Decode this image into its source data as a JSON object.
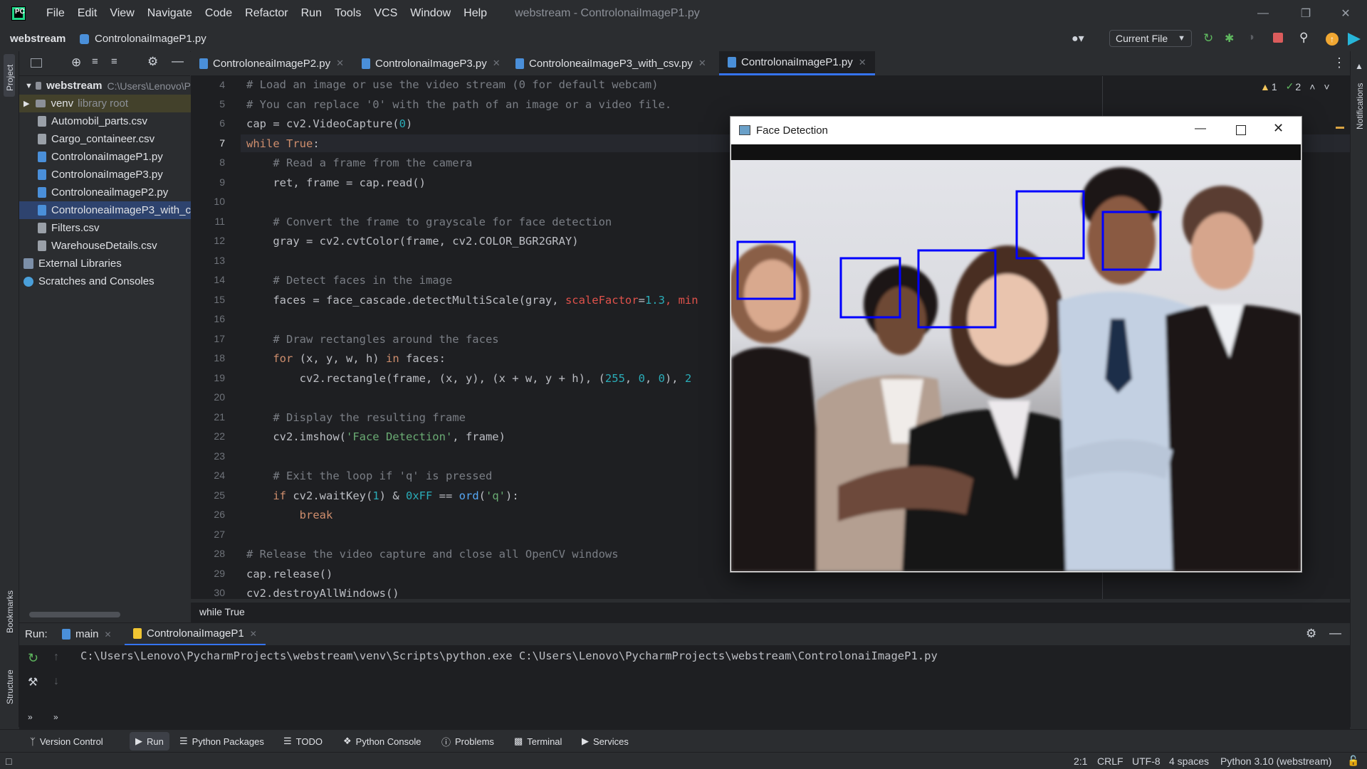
{
  "window": {
    "title": "webstream - ControlonaiImageP1.py"
  },
  "menu": [
    "File",
    "Edit",
    "View",
    "Navigate",
    "Code",
    "Refactor",
    "Run",
    "Tools",
    "VCS",
    "Window",
    "Help"
  ],
  "nav": {
    "project": "webstream",
    "file": "ControlonaiImageP1.py",
    "run_config": "Current File"
  },
  "left_stripe": {
    "project": "Project",
    "bookmarks": "Bookmarks",
    "structure": "Structure"
  },
  "right_stripe": {
    "notifications": "Notifications"
  },
  "project_tree": {
    "root": {
      "name": "webstream",
      "path": "C:\\Users\\Lenovo\\Py"
    },
    "venv": {
      "name": "venv",
      "hint": "library root"
    },
    "files": [
      "Automobil_parts.csv",
      "Cargo_containeer.csv",
      "ControlonaiImageP1.py",
      "ControlonaiImageP3.py",
      "ControloneailmageP2.py",
      "ControloneaiImageP3_with_c",
      "Filters.csv",
      "WarehouseDetails.csv"
    ],
    "external": "External Libraries",
    "scratches": "Scratches and Consoles"
  },
  "tabs": [
    "ControloneaiImageP2.py",
    "ControlonaiImageP3.py",
    "ControloneaiImageP3_with_csv.py",
    "ControlonaiImageP1.py"
  ],
  "inspections": {
    "warnings": "1",
    "checks": "2"
  },
  "line_numbers": [
    "4",
    "5",
    "6",
    "7",
    "8",
    "9",
    "10",
    "11",
    "12",
    "13",
    "14",
    "15",
    "16",
    "17",
    "18",
    "19",
    "20",
    "21",
    "22",
    "23",
    "24",
    "25",
    "26",
    "27",
    "28",
    "29",
    "30"
  ],
  "code": {
    "l4": "# Load an image or use the video stream (0 for default webcam)",
    "l5": "# You can replace '0' with the path of an image or a video file.",
    "l6a": "cap = cv2.VideoCapture(",
    "l6b": "0",
    "l6c": ")",
    "l7a": "while True",
    "l7b": ":",
    "l8": "    # Read a frame from the camera",
    "l9": "    ret, frame = cap.read()",
    "l11": "    # Convert the frame to grayscale for face detection",
    "l12": "    gray = cv2.cvtColor(frame, cv2.COLOR_BGR2GRAY)",
    "l14": "    # Detect faces in the image",
    "l15a": "    faces = face_cascade.detectMultiScale(gray, ",
    "l15b": "scaleFactor",
    "l15c": "=",
    "l15d": "1.3",
    "l15e": ", min",
    "l17": "    # Draw rectangles around the faces",
    "l18a": "    for",
    "l18b": " (x, y, w, h) ",
    "l18c": "in",
    "l18d": " faces:",
    "l19a": "        cv2.rectangle(frame, (x, y), (x + w, y + h), (",
    "l19b": "255",
    "l19c": ", ",
    "l19d": "0",
    "l19e": ", ",
    "l19f": "0",
    "l19g": "), ",
    "l19h": "2",
    "l21": "    # Display the resulting frame",
    "l22a": "    cv2.imshow(",
    "l22b": "'Face Detection'",
    "l22c": ", frame)",
    "l24": "    # Exit the loop if 'q' is pressed",
    "l25a": "    if",
    "l25b": " cv2.waitKey(",
    "l25c": "1",
    "l25d": ") & ",
    "l25e": "0xFF",
    "l25f": " == ",
    "l25g": "ord",
    "l25h": "(",
    "l25i": "'q'",
    "l25j": "):",
    "l26": "        break",
    "l28": "# Release the video capture and close all OpenCV windows",
    "l29": "cap.release()",
    "l30": "cv2.destroyAllWindows()"
  },
  "breadcrumb": "while True",
  "run": {
    "label": "Run:",
    "tabs": [
      "main",
      "ControlonaiImageP1"
    ],
    "output": "C:\\Users\\Lenovo\\PycharmProjects\\webstream\\venv\\Scripts\\python.exe C:\\Users\\Lenovo\\PycharmProjects\\webstream\\ControlonaiImageP1.py"
  },
  "bottom_tabs": [
    "Version Control",
    "Run",
    "Python Packages",
    "TODO",
    "Python Console",
    "Problems",
    "Terminal",
    "Services"
  ],
  "status": {
    "position": "2:1",
    "line_sep": "CRLF",
    "encoding": "UTF-8",
    "indent": "4 spaces",
    "interpreter": "Python 3.10 (webstream)"
  },
  "face_window": {
    "title": "Face Detection",
    "detections": 5,
    "box_color": "#0000ff"
  },
  "colors": {
    "accent": "#21d789",
    "selection": "#2e436e",
    "box": "#0000ff"
  }
}
